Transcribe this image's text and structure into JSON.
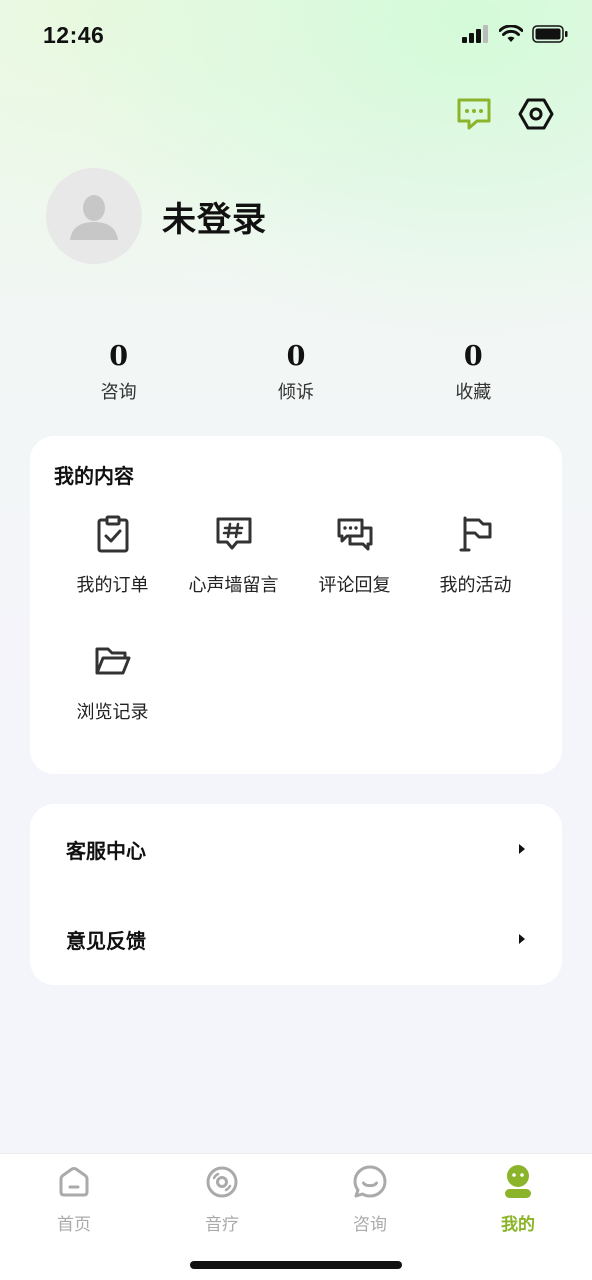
{
  "status_bar": {
    "time": "12:46"
  },
  "profile": {
    "username": "未登录"
  },
  "stats": [
    {
      "value": "0",
      "label": "咨询"
    },
    {
      "value": "0",
      "label": "倾诉"
    },
    {
      "value": "0",
      "label": "收藏"
    }
  ],
  "my_content": {
    "title": "我的内容",
    "items": [
      {
        "label": "我的订单",
        "icon": "clipboard-check-icon"
      },
      {
        "label": "心声墙留言",
        "icon": "hashtag-message-icon"
      },
      {
        "label": "评论回复",
        "icon": "chat-bubbles-icon"
      },
      {
        "label": "我的活动",
        "icon": "flag-icon"
      },
      {
        "label": "浏览记录",
        "icon": "folder-open-icon"
      }
    ]
  },
  "menu": [
    {
      "label": "客服中心"
    },
    {
      "label": "意见反馈"
    }
  ],
  "tabbar": [
    {
      "label": "首页",
      "icon": "home-icon"
    },
    {
      "label": "音疗",
      "icon": "disc-icon"
    },
    {
      "label": "咨询",
      "icon": "smile-chat-icon"
    },
    {
      "label": "我的",
      "icon": "profile-icon"
    }
  ],
  "colors": {
    "accent": "#8bb42a",
    "inactive": "#aaaaaa"
  }
}
